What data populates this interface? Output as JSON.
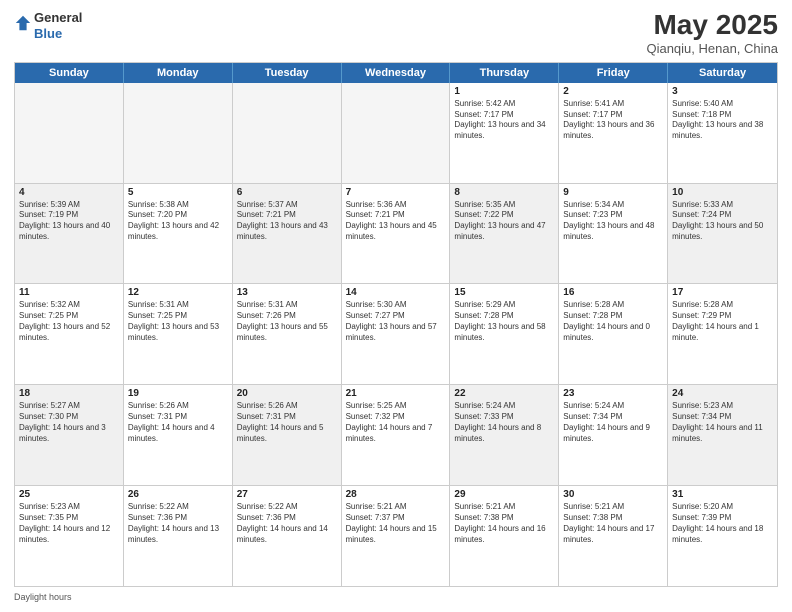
{
  "header": {
    "logo_line1": "General",
    "logo_line2": "Blue",
    "month": "May 2025",
    "location": "Qianqiu, Henan, China"
  },
  "days_of_week": [
    "Sunday",
    "Monday",
    "Tuesday",
    "Wednesday",
    "Thursday",
    "Friday",
    "Saturday"
  ],
  "footer": {
    "label": "Daylight hours"
  },
  "rows": [
    [
      {
        "day": "",
        "empty": true
      },
      {
        "day": "",
        "empty": true
      },
      {
        "day": "",
        "empty": true
      },
      {
        "day": "",
        "empty": true
      },
      {
        "day": "1",
        "sunrise": "5:42 AM",
        "sunset": "7:17 PM",
        "daylight": "13 hours and 34 minutes."
      },
      {
        "day": "2",
        "sunrise": "5:41 AM",
        "sunset": "7:17 PM",
        "daylight": "13 hours and 36 minutes."
      },
      {
        "day": "3",
        "sunrise": "5:40 AM",
        "sunset": "7:18 PM",
        "daylight": "13 hours and 38 minutes."
      }
    ],
    [
      {
        "day": "4",
        "sunrise": "5:39 AM",
        "sunset": "7:19 PM",
        "daylight": "13 hours and 40 minutes."
      },
      {
        "day": "5",
        "sunrise": "5:38 AM",
        "sunset": "7:20 PM",
        "daylight": "13 hours and 42 minutes."
      },
      {
        "day": "6",
        "sunrise": "5:37 AM",
        "sunset": "7:21 PM",
        "daylight": "13 hours and 43 minutes."
      },
      {
        "day": "7",
        "sunrise": "5:36 AM",
        "sunset": "7:21 PM",
        "daylight": "13 hours and 45 minutes."
      },
      {
        "day": "8",
        "sunrise": "5:35 AM",
        "sunset": "7:22 PM",
        "daylight": "13 hours and 47 minutes."
      },
      {
        "day": "9",
        "sunrise": "5:34 AM",
        "sunset": "7:23 PM",
        "daylight": "13 hours and 48 minutes."
      },
      {
        "day": "10",
        "sunrise": "5:33 AM",
        "sunset": "7:24 PM",
        "daylight": "13 hours and 50 minutes."
      }
    ],
    [
      {
        "day": "11",
        "sunrise": "5:32 AM",
        "sunset": "7:25 PM",
        "daylight": "13 hours and 52 minutes."
      },
      {
        "day": "12",
        "sunrise": "5:31 AM",
        "sunset": "7:25 PM",
        "daylight": "13 hours and 53 minutes."
      },
      {
        "day": "13",
        "sunrise": "5:31 AM",
        "sunset": "7:26 PM",
        "daylight": "13 hours and 55 minutes."
      },
      {
        "day": "14",
        "sunrise": "5:30 AM",
        "sunset": "7:27 PM",
        "daylight": "13 hours and 57 minutes."
      },
      {
        "day": "15",
        "sunrise": "5:29 AM",
        "sunset": "7:28 PM",
        "daylight": "13 hours and 58 minutes."
      },
      {
        "day": "16",
        "sunrise": "5:28 AM",
        "sunset": "7:28 PM",
        "daylight": "14 hours and 0 minutes."
      },
      {
        "day": "17",
        "sunrise": "5:28 AM",
        "sunset": "7:29 PM",
        "daylight": "14 hours and 1 minute."
      }
    ],
    [
      {
        "day": "18",
        "sunrise": "5:27 AM",
        "sunset": "7:30 PM",
        "daylight": "14 hours and 3 minutes."
      },
      {
        "day": "19",
        "sunrise": "5:26 AM",
        "sunset": "7:31 PM",
        "daylight": "14 hours and 4 minutes."
      },
      {
        "day": "20",
        "sunrise": "5:26 AM",
        "sunset": "7:31 PM",
        "daylight": "14 hours and 5 minutes."
      },
      {
        "day": "21",
        "sunrise": "5:25 AM",
        "sunset": "7:32 PM",
        "daylight": "14 hours and 7 minutes."
      },
      {
        "day": "22",
        "sunrise": "5:24 AM",
        "sunset": "7:33 PM",
        "daylight": "14 hours and 8 minutes."
      },
      {
        "day": "23",
        "sunrise": "5:24 AM",
        "sunset": "7:34 PM",
        "daylight": "14 hours and 9 minutes."
      },
      {
        "day": "24",
        "sunrise": "5:23 AM",
        "sunset": "7:34 PM",
        "daylight": "14 hours and 11 minutes."
      }
    ],
    [
      {
        "day": "25",
        "sunrise": "5:23 AM",
        "sunset": "7:35 PM",
        "daylight": "14 hours and 12 minutes."
      },
      {
        "day": "26",
        "sunrise": "5:22 AM",
        "sunset": "7:36 PM",
        "daylight": "14 hours and 13 minutes."
      },
      {
        "day": "27",
        "sunrise": "5:22 AM",
        "sunset": "7:36 PM",
        "daylight": "14 hours and 14 minutes."
      },
      {
        "day": "28",
        "sunrise": "5:21 AM",
        "sunset": "7:37 PM",
        "daylight": "14 hours and 15 minutes."
      },
      {
        "day": "29",
        "sunrise": "5:21 AM",
        "sunset": "7:38 PM",
        "daylight": "14 hours and 16 minutes."
      },
      {
        "day": "30",
        "sunrise": "5:21 AM",
        "sunset": "7:38 PM",
        "daylight": "14 hours and 17 minutes."
      },
      {
        "day": "31",
        "sunrise": "5:20 AM",
        "sunset": "7:39 PM",
        "daylight": "14 hours and 18 minutes."
      }
    ]
  ]
}
